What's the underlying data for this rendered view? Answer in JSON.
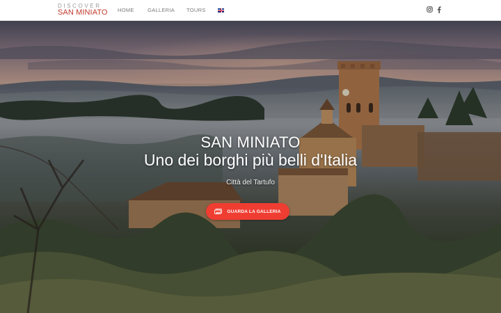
{
  "header": {
    "logo_top": "DISCOVER",
    "logo_bottom": "SAN MINIATO",
    "nav": [
      {
        "label": "HOME"
      },
      {
        "label": "GALLERIA"
      },
      {
        "label": "TOURS"
      }
    ],
    "language_icon": "uk-flag-icon",
    "social_icons": [
      "instagram-icon",
      "facebook-icon"
    ]
  },
  "hero": {
    "title_line1": "SAN MINIATO",
    "title_line2": "Uno dei borghi più belli d'Italia",
    "subtitle": "Città del Tartufo",
    "cta_label": "GUARDA LA GALLERIA",
    "cta_icon": "gallery-icon"
  },
  "colors": {
    "brand_red": "#c0392b",
    "cta_red": "#ef3d32",
    "nav_text": "#7a7a7a"
  }
}
